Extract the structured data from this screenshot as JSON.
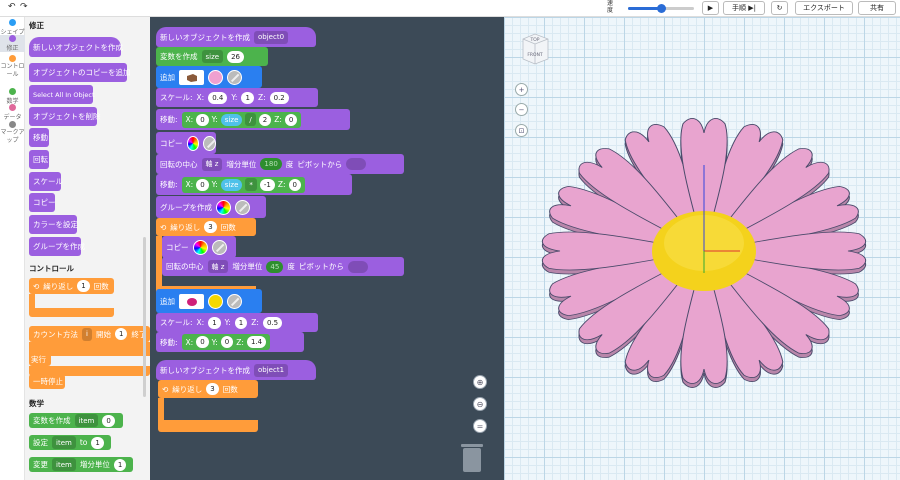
{
  "topbar": {
    "undo_icon": "undo-icon",
    "redo_icon": "redo-icon",
    "speed_label": "速度",
    "speed_level": 0.5,
    "play_icon": "play-icon",
    "step_label": "手順",
    "reset_icon": "reset-icon",
    "export_label": "エクスポート",
    "share_label": "共有"
  },
  "categories": [
    {
      "label": "シェイプ",
      "color": "#2a9df4"
    },
    {
      "label": "修正",
      "color": "#9b5fe0",
      "selected": true
    },
    {
      "label": "コントロール",
      "color": "#ff9c3a"
    },
    {
      "label": "数学",
      "color": "#4cb34c"
    },
    {
      "label": "データ",
      "color": "#e06a9b"
    },
    {
      "label": "マークアップ",
      "color": "#888888"
    }
  ],
  "flyout": {
    "modify_heading": "修正",
    "modify_blocks": [
      "新しいオブジェクトを作成",
      "オブジェクトのコピーを追加",
      "Select All In Object",
      "オブジェクトを削除",
      "移動",
      "回転",
      "スケール",
      "コピー",
      "カラーを設定",
      "グループを作成"
    ],
    "control_heading": "コントロール",
    "repeat_label": "繰り返し",
    "repeat_count": "1",
    "repeat_unit": "回数",
    "count_label": "カウント方法",
    "count_var": "i",
    "count_start_label": "開始",
    "count_start": "1",
    "count_end_label": "終了",
    "execute_label": "実行",
    "stop_label": "一時停止",
    "math_heading": "数学",
    "create_var_label": "変数を作成",
    "create_var_name": "item",
    "create_var_value": "0",
    "set_label": "設定",
    "set_var": "item",
    "set_to": "to",
    "set_value": "1",
    "change_label": "変更",
    "change_var": "item",
    "change_by": "増分単位",
    "change_value": "1"
  },
  "workspace": {
    "obj0": {
      "label": "新しいオブジェクトを作成",
      "name": "object0"
    },
    "var": {
      "label": "変数を作成",
      "name": "size",
      "value": "26"
    },
    "add1": {
      "label": "追加",
      "color": "#f0a0d0"
    },
    "scale1": {
      "label": "スケール:",
      "x": "0.4",
      "y": "1",
      "z": "0.2"
    },
    "move1": {
      "label": "移動:",
      "x": "0",
      "ylabel": "Y:",
      "yvar": "size",
      "op": "/",
      "yval": "2",
      "z": "0"
    },
    "copy1": {
      "label": "コピー"
    },
    "rot1": {
      "label": "回転の中心",
      "axis": "軸 z",
      "step_label": "増分単位",
      "deg": "180",
      "deg_unit": "度",
      "pivot": "ピボットから"
    },
    "move2": {
      "label": "移動:",
      "x": "0",
      "yvar": "size",
      "op": "*",
      "yval": "-1",
      "z": "0"
    },
    "group": {
      "label": "グループを作成"
    },
    "repeat": {
      "label": "繰り返し",
      "count": "3",
      "unit": "回数"
    },
    "copy2": {
      "label": "コピー"
    },
    "rot2": {
      "label": "回転の中心",
      "axis": "軸 z",
      "step_label": "増分単位",
      "deg": "45",
      "deg_unit": "度",
      "pivot": "ピボットから"
    },
    "add2": {
      "label": "追加",
      "color": "#f5d800"
    },
    "scale2": {
      "label": "スケール:",
      "x": "1",
      "y": "1",
      "z": "0.5"
    },
    "move3": {
      "label": "移動:",
      "x": "0",
      "y": "0",
      "z": "1.4"
    },
    "obj1": {
      "label": "新しいオブジェクトを作成",
      "name": "object1"
    },
    "repeat2": {
      "label": "繰り返し",
      "count": "3",
      "unit": "回数"
    }
  },
  "viewcube": {
    "top": "TOP",
    "front": "FRONT"
  },
  "colors": {
    "petal": "#e8a4cf",
    "petal_edge": "#4a4a6a",
    "center": "#f4d21c",
    "block_purple": "#9b5fe0",
    "block_green": "#4cb34c",
    "block_orange": "#ff9c3a"
  }
}
